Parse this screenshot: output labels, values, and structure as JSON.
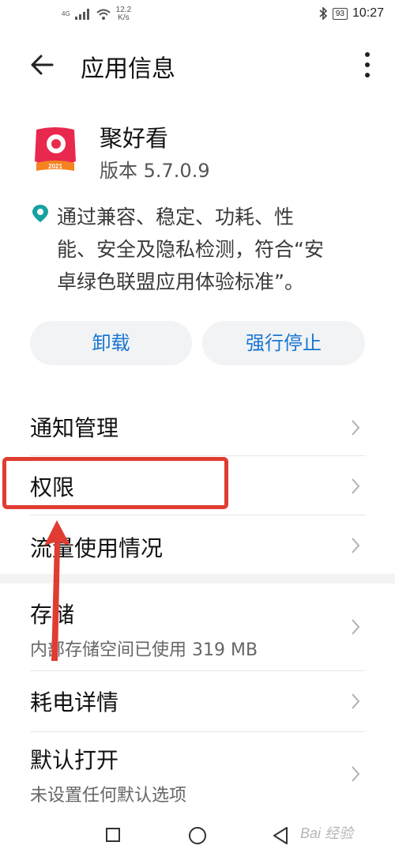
{
  "status_bar": {
    "network": "4G",
    "speed_value": "12.2",
    "speed_unit": "K/s",
    "battery": "93",
    "time": "10:27"
  },
  "header": {
    "title": "应用信息"
  },
  "app": {
    "name": "聚好看",
    "version": "版本 5.7.0.9",
    "icon_badge": "2021"
  },
  "certification": {
    "lines": [
      "通过兼容、稳定、功耗、性",
      "能、安全及隐私检测，符合“安",
      "卓绿色联盟应用体验标准”。"
    ]
  },
  "actions": {
    "uninstall": "卸载",
    "force_stop": "强行停止"
  },
  "settings": [
    {
      "label": "通知管理"
    },
    {
      "label": "权限"
    },
    {
      "label": "流量使用情况"
    },
    {
      "label": "存储",
      "sub": "内部存储空间已使用 319 MB"
    },
    {
      "label": "耗电详情"
    },
    {
      "label": "默认打开",
      "sub": "未设置任何默认选项"
    }
  ],
  "colors": {
    "accent": "#1976d2",
    "highlight": "#e03c31",
    "icon_red": "#e8294d"
  },
  "watermark": "Bai 经验"
}
